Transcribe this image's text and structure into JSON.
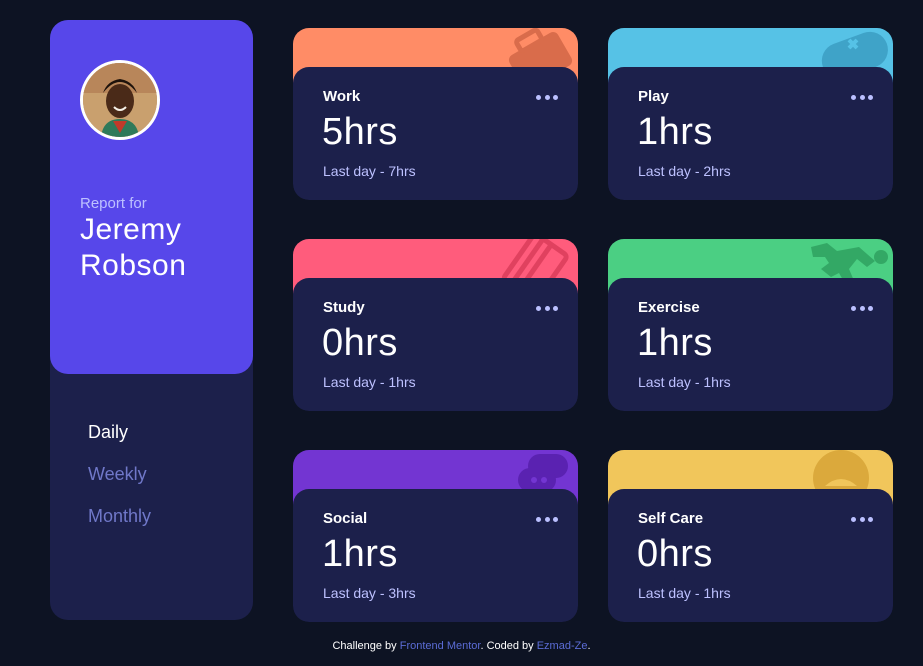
{
  "profile": {
    "report_for": "Report for",
    "name": "Jeremy Robson",
    "periods": [
      "Daily",
      "Weekly",
      "Monthly"
    ],
    "active_period": "Daily"
  },
  "cards": [
    {
      "title": "Work",
      "hours": "5hrs",
      "previous": "Last day - 7hrs",
      "color": "#ff8c66",
      "icon": "briefcase-icon"
    },
    {
      "title": "Play",
      "hours": "1hrs",
      "previous": "Last day - 2hrs",
      "color": "#56c2e6",
      "icon": "gamepad-icon"
    },
    {
      "title": "Study",
      "hours": "0hrs",
      "previous": "Last day - 1hrs",
      "color": "#ff5c7c",
      "icon": "book-icon"
    },
    {
      "title": "Exercise",
      "hours": "1hrs",
      "previous": "Last day - 1hrs",
      "color": "#4bcf83",
      "icon": "runner-icon"
    },
    {
      "title": "Social",
      "hours": "1hrs",
      "previous": "Last day - 3hrs",
      "color": "#7335d2",
      "icon": "chat-icon"
    },
    {
      "title": "Self Care",
      "hours": "0hrs",
      "previous": "Last day - 1hrs",
      "color": "#f1c65b",
      "icon": "self-care-icon"
    }
  ],
  "footer": {
    "challenge_by": "Challenge by",
    "frontend_mentor": "Frontend Mentor",
    "coded_by": ". Coded by",
    "author": "Ezmad-Ze",
    "end": "."
  },
  "colors": {
    "background": "#0d1323",
    "card": "#1c204b",
    "accent": "#5747ea",
    "muted": "#7078c9",
    "pale": "#bdc1ff"
  }
}
